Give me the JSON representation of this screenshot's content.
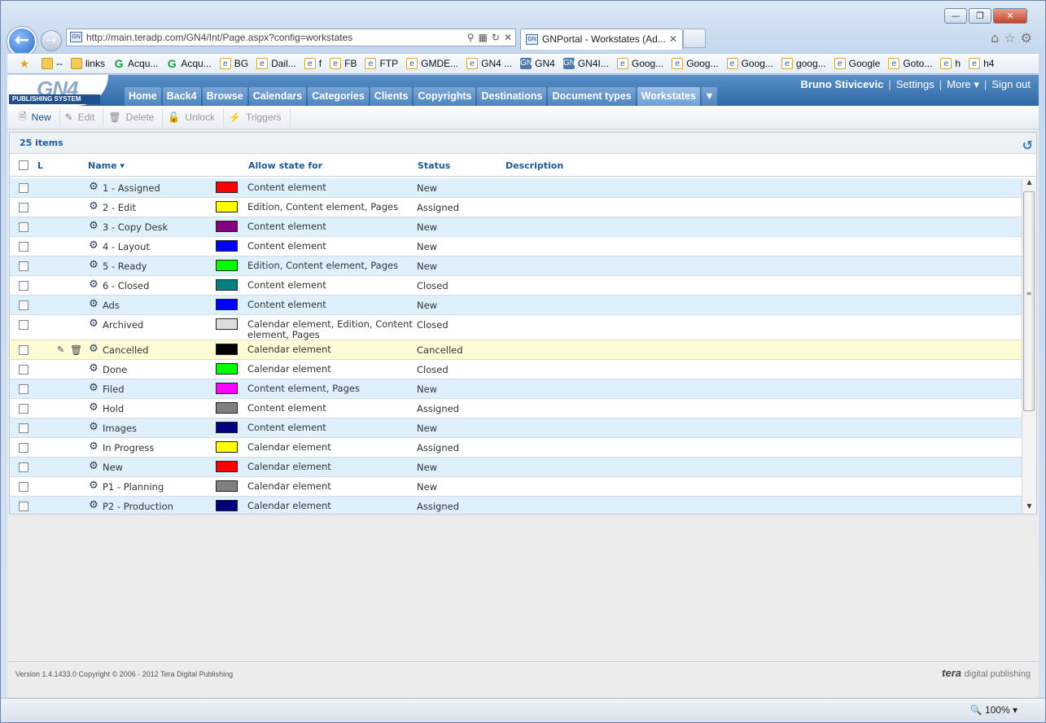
{
  "browser": {
    "url": "http://main.teradp.com/GN4/Int/Page.aspx?config=workstates",
    "tab_title": "GNPortal - Workstates (Ad...",
    "zoom": "100%",
    "window_controls": [
      "—",
      "❐",
      "✕"
    ]
  },
  "favorites": [
    {
      "icon": "star",
      "label": ""
    },
    {
      "icon": "folder",
      "label": "--"
    },
    {
      "icon": "folder",
      "label": "links"
    },
    {
      "icon": "g",
      "label": "Acqu..."
    },
    {
      "icon": "g",
      "label": "Acqu..."
    },
    {
      "icon": "ie",
      "label": "BG"
    },
    {
      "icon": "ie",
      "label": "Dail..."
    },
    {
      "icon": "ie",
      "label": "f"
    },
    {
      "icon": "ie",
      "label": "FB"
    },
    {
      "icon": "ie",
      "label": "FTP"
    },
    {
      "icon": "ie",
      "label": "GMDE..."
    },
    {
      "icon": "ie",
      "label": "GN4 ..."
    },
    {
      "icon": "gn",
      "label": "GN4"
    },
    {
      "icon": "gn",
      "label": "GN4I..."
    },
    {
      "icon": "ie",
      "label": "Goog..."
    },
    {
      "icon": "ie",
      "label": "Goog..."
    },
    {
      "icon": "ie",
      "label": "Goog..."
    },
    {
      "icon": "ie",
      "label": "goog..."
    },
    {
      "icon": "ie",
      "label": "Google"
    },
    {
      "icon": "ie",
      "label": "Goto..."
    },
    {
      "icon": "ie",
      "label": "h"
    },
    {
      "icon": "ie",
      "label": "h4"
    }
  ],
  "app": {
    "logo_text": "GN4",
    "logo_sub": "PUBLISHING SYSTEM",
    "user": "Bruno Stivicevic",
    "settings": "Settings",
    "more": "More ▾",
    "signout": "Sign out",
    "tabs": [
      "Home",
      "Back4",
      "Browse",
      "Calendars",
      "Categories",
      "Clients",
      "Copyrights",
      "Destinations",
      "Document types",
      "Workstates"
    ],
    "active_tab": "Workstates"
  },
  "toolbar": {
    "new": "New",
    "edit": "Edit",
    "delete": "Delete",
    "unlock": "Unlock",
    "triggers": "Triggers"
  },
  "grid": {
    "count": "25 items",
    "columns": {
      "lock": "L",
      "name": "Name ▾",
      "allow": "Allow state for",
      "status": "Status",
      "description": "Description"
    },
    "rows": [
      {
        "name": "1 - Assigned",
        "color": "#ff0000",
        "allow": "Content element",
        "status": "New"
      },
      {
        "name": "2 - Edit",
        "color": "#ffff00",
        "allow": "Edition, Content element, Pages",
        "status": "Assigned"
      },
      {
        "name": "3 - Copy Desk",
        "color": "#800080",
        "allow": "Content element",
        "status": "New"
      },
      {
        "name": "4 - Layout",
        "color": "#0000ff",
        "allow": "Content element",
        "status": "New"
      },
      {
        "name": "5 - Ready",
        "color": "#00ff00",
        "allow": "Edition, Content element, Pages",
        "status": "New"
      },
      {
        "name": "6 - Closed",
        "color": "#008080",
        "allow": "Content element",
        "status": "Closed"
      },
      {
        "name": "Ads",
        "color": "#0000ff",
        "allow": "Content element",
        "status": "New"
      },
      {
        "name": "Archived",
        "color": "#dddddd",
        "allow": "Calendar element, Edition, Content element, Pages",
        "status": "Closed"
      },
      {
        "name": "Cancelled",
        "color": "#000000",
        "allow": "Calendar element",
        "status": "Cancelled"
      },
      {
        "name": "Done",
        "color": "#00ff00",
        "allow": "Calendar element",
        "status": "Closed"
      },
      {
        "name": "Filed",
        "color": "#ff00ff",
        "allow": "Content element, Pages",
        "status": "New"
      },
      {
        "name": "Hold",
        "color": "#808080",
        "allow": "Content element",
        "status": "Assigned"
      },
      {
        "name": "Images",
        "color": "#000080",
        "allow": "Content element",
        "status": "New"
      },
      {
        "name": "In Progress",
        "color": "#ffff00",
        "allow": "Calendar element",
        "status": "Assigned"
      },
      {
        "name": "New",
        "color": "#ff0000",
        "allow": "Calendar element",
        "status": "New"
      },
      {
        "name": "P1 - Planning",
        "color": "#808080",
        "allow": "Calendar element",
        "status": "New"
      },
      {
        "name": "P2 - Production",
        "color": "#000080",
        "allow": "Calendar element",
        "status": "Assigned"
      }
    ]
  },
  "footer": {
    "copyright": "Version 1.4.1433.0 Copyright © 2006 - 2012 Tera Digital Publishing",
    "brand": "tera",
    "brand_sub": "digital publishing"
  }
}
